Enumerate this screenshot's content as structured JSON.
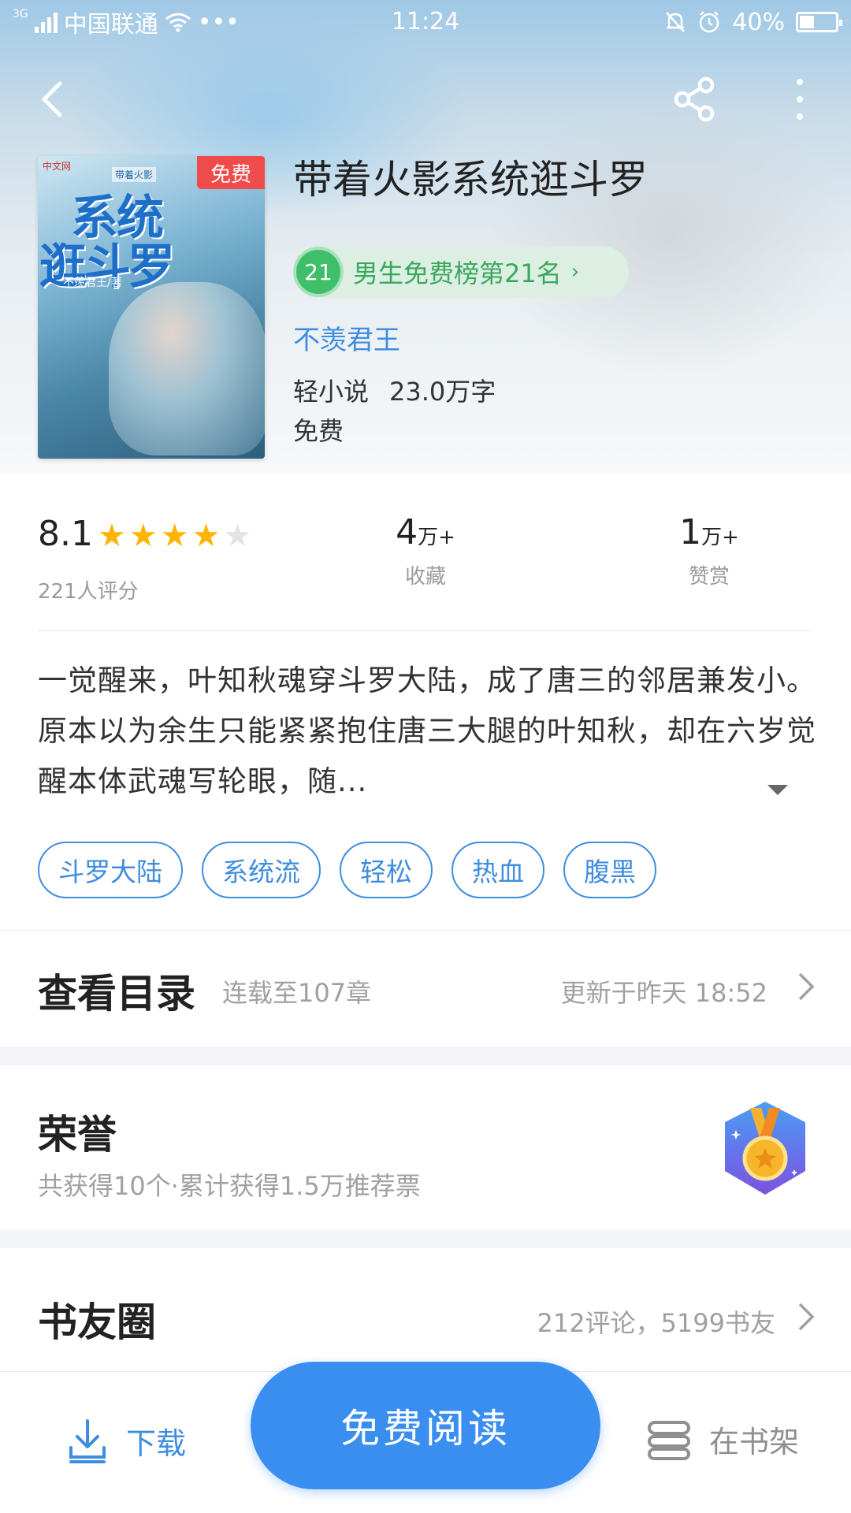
{
  "status_bar": {
    "network": "3G",
    "carrier": "中国联通",
    "dots": "•••",
    "time": "11:24",
    "battery": "40%",
    "battery_level": 0.4
  },
  "nav": {
    "back_icon": "chevron-left-icon",
    "share_icon": "share-icon",
    "more_icon": "more-vertical-icon"
  },
  "book": {
    "title": "带着火影系统逛斗罗",
    "cover": {
      "badge": "免费",
      "title_line1": "系统",
      "title_line2": "逛斗罗",
      "small_title": "带着火影",
      "author_text": "不羡君王/著",
      "publisher": "中文网"
    },
    "rank": {
      "number": "21",
      "label": "男生免费榜第21名",
      "chevron": "›"
    },
    "author": "不羡君王",
    "category": "轻小说",
    "word_count": "23.0万字",
    "price": "免费"
  },
  "stats": {
    "score": "8.1",
    "stars": 4,
    "stars_max": 5,
    "raters": "221人评分",
    "favorites_value": "4",
    "favorites_unit": "万+",
    "favorites_label": "收藏",
    "rewards_value": "1",
    "rewards_unit": "万+",
    "rewards_label": "赞赏"
  },
  "description": "一觉醒来，叶知秋魂穿斗罗大陆，成了唐三的邻居兼发小。原本以为余生只能紧紧抱住唐三大腿的叶知秋，却在六岁觉醒本体武魂写轮眼，随...",
  "tags": [
    "斗罗大陆",
    "系统流",
    "轻松",
    "热血",
    "腹黑"
  ],
  "catalog": {
    "title": "查看目录",
    "status": "连载至107章",
    "updated": "更新于昨天 18:52"
  },
  "honor": {
    "title": "荣誉",
    "summary": "共获得10个·累计获得1.5万推荐票",
    "icon": "medal-icon"
  },
  "book_circle": {
    "title": "书友圈",
    "summary": "212评论，5199书友"
  },
  "bottom_bar": {
    "download_label": "下载",
    "read_label": "免费阅读",
    "shelf_label": "在书架"
  },
  "colors": {
    "accent": "#3a8ef0",
    "link": "#3f8de0",
    "rank_green": "#3fbf6a",
    "star": "#ffb400",
    "badge_red": "#f04b4b"
  }
}
